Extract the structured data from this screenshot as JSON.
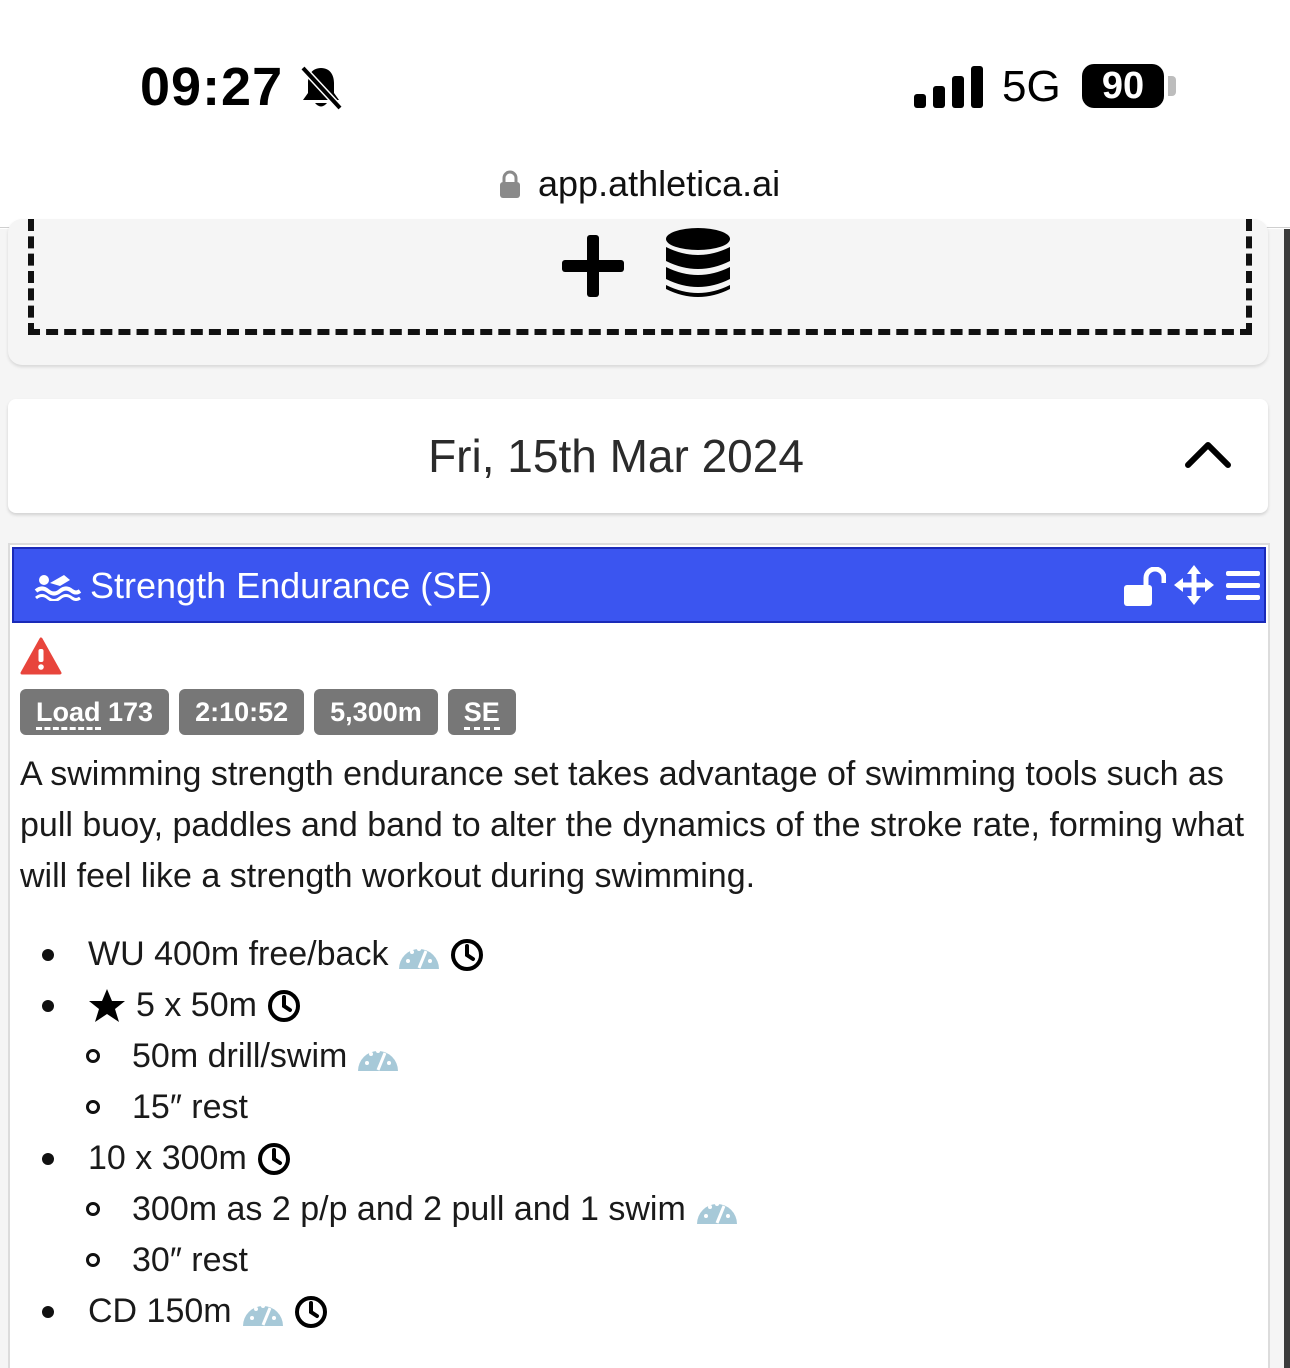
{
  "status_bar": {
    "time": "09:27",
    "network": "5G",
    "battery": "90"
  },
  "browser": {
    "url": "app.athletica.ai"
  },
  "day": {
    "date": "Fri, 15th Mar 2024"
  },
  "workout": {
    "title": "Strength Endurance (SE)",
    "badges": {
      "load_label": "Load",
      "load_value": "173",
      "duration": "2:10:52",
      "distance": "5,300m",
      "type": "SE"
    },
    "description": "A swimming strength endurance set takes advantage of swimming tools such as pull buoy, paddles and band to alter the dynamics of the stroke rate, forming what will feel like a strength workout during swimming.",
    "steps": [
      {
        "text": "WU 400m free/back"
      },
      {
        "text": "5 x 50m",
        "children": [
          {
            "text": "50m drill/swim"
          },
          {
            "text": "15″ rest"
          }
        ]
      },
      {
        "text": "10 x 300m",
        "children": [
          {
            "text": "300m as 2 p/p and 2 pull and 1 swim"
          },
          {
            "text": "30″ rest"
          }
        ]
      },
      {
        "text": "CD 150m"
      }
    ]
  },
  "colors": {
    "header_blue": "#3b55f0",
    "badge_gray": "#777777",
    "warning_red": "#e8453c",
    "gauge_blue": "#a7c9d8"
  },
  "icons": [
    "bell-slash-icon",
    "signal-icon",
    "lock-icon",
    "plus-icon",
    "database-icon",
    "chevron-up-icon",
    "swimmer-icon",
    "unlock-icon",
    "move-icon",
    "menu-icon",
    "warning-icon",
    "gauge-icon",
    "clock-icon",
    "star-icon"
  ]
}
